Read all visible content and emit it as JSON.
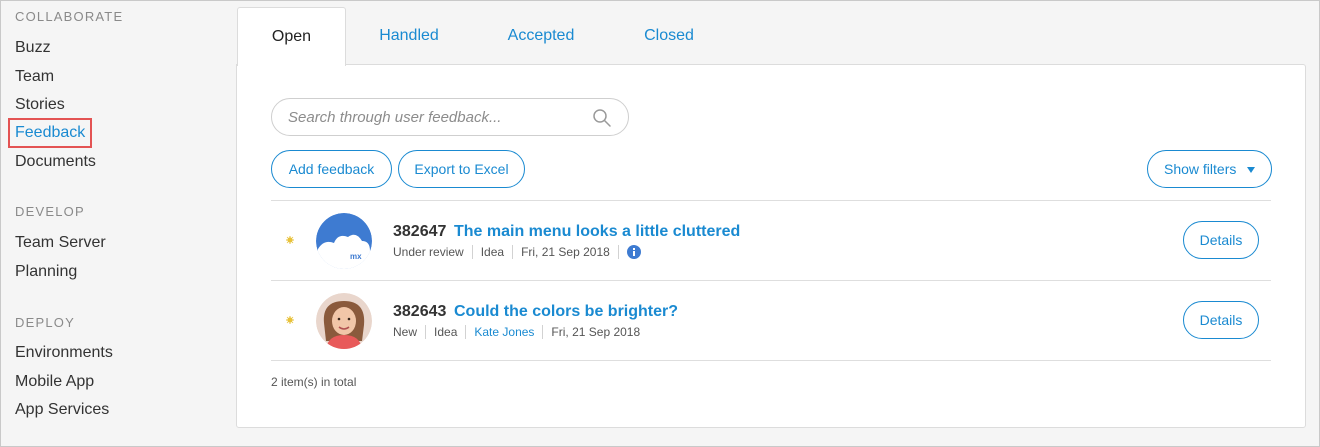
{
  "sidebar": {
    "sections": [
      {
        "header": "COLLABORATE",
        "items": [
          "Buzz",
          "Team",
          "Stories",
          "Feedback",
          "Documents"
        ]
      },
      {
        "header": "DEVELOP",
        "items": [
          "Team Server",
          "Planning"
        ]
      },
      {
        "header": "DEPLOY",
        "items": [
          "Environments",
          "Mobile App",
          "App Services"
        ]
      }
    ],
    "active_item": "Feedback"
  },
  "tabs": [
    "Open",
    "Handled",
    "Accepted",
    "Closed"
  ],
  "active_tab": "Open",
  "search": {
    "placeholder": "Search through user feedback..."
  },
  "actions": {
    "add_feedback": "Add feedback",
    "export_excel": "Export to Excel",
    "show_filters": "Show filters"
  },
  "feedback_items": [
    {
      "id": "382647",
      "title": "The main menu looks a little cluttered",
      "status": "Under review",
      "type": "Idea",
      "date": "Fri, 21 Sep 2018",
      "avatar_text": "mx",
      "details_label": "Details"
    },
    {
      "id": "382643",
      "title": "Could the colors be brighter?",
      "status": "New",
      "type": "Idea",
      "author": "Kate Jones",
      "date": "Fri, 21 Sep 2018",
      "details_label": "Details"
    }
  ],
  "total_text": "2 item(s) in total",
  "colors": {
    "accent": "#1a8ad1",
    "highlight": "#e35353",
    "bullet": "#e8c23a"
  }
}
